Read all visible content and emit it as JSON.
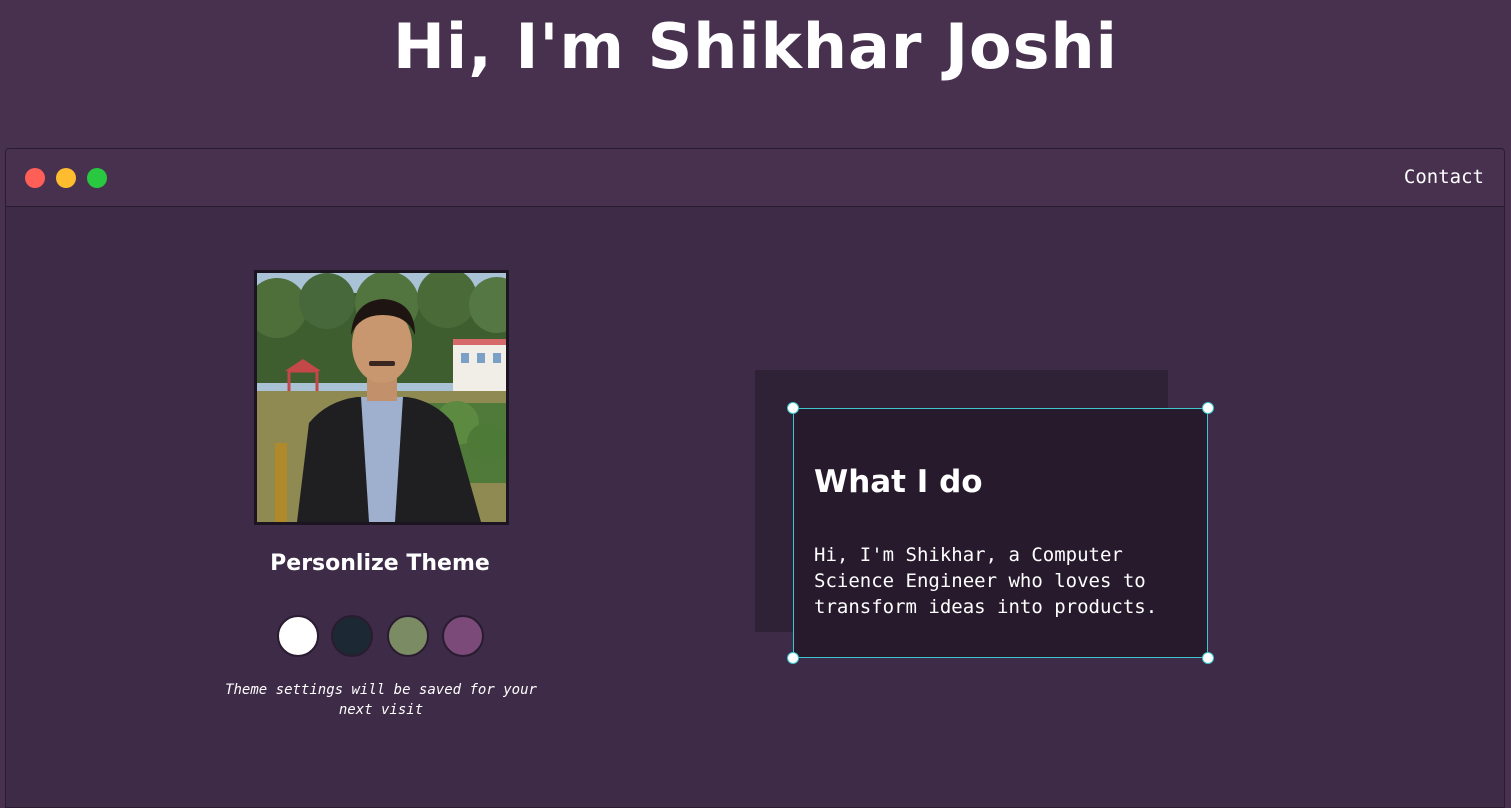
{
  "hero": {
    "title": "Hi, I'm Shikhar Joshi"
  },
  "window": {
    "traffic_lights": {
      "red": "#ff5f57",
      "yellow": "#febc2e",
      "green": "#28c840"
    },
    "nav": {
      "contact_label": "Contact"
    }
  },
  "profile": {
    "photo_icon": "profile-photo"
  },
  "theme": {
    "title": "Personlize Theme",
    "swatches": [
      {
        "color": "#ffffff"
      },
      {
        "color": "#1c2833"
      },
      {
        "color": "#7b8c65"
      },
      {
        "color": "#7b4a78"
      }
    ],
    "note": "Theme settings will be saved for your next visit"
  },
  "about": {
    "title": "What I do",
    "text": "Hi, I'm Shikhar, a Computer Science Engineer who loves to transform ideas into products."
  },
  "colors": {
    "page_bg": "#47314f",
    "content_bg": "#3e2b47",
    "card_bg": "#261a2c",
    "accent": "#3fc6cc"
  }
}
